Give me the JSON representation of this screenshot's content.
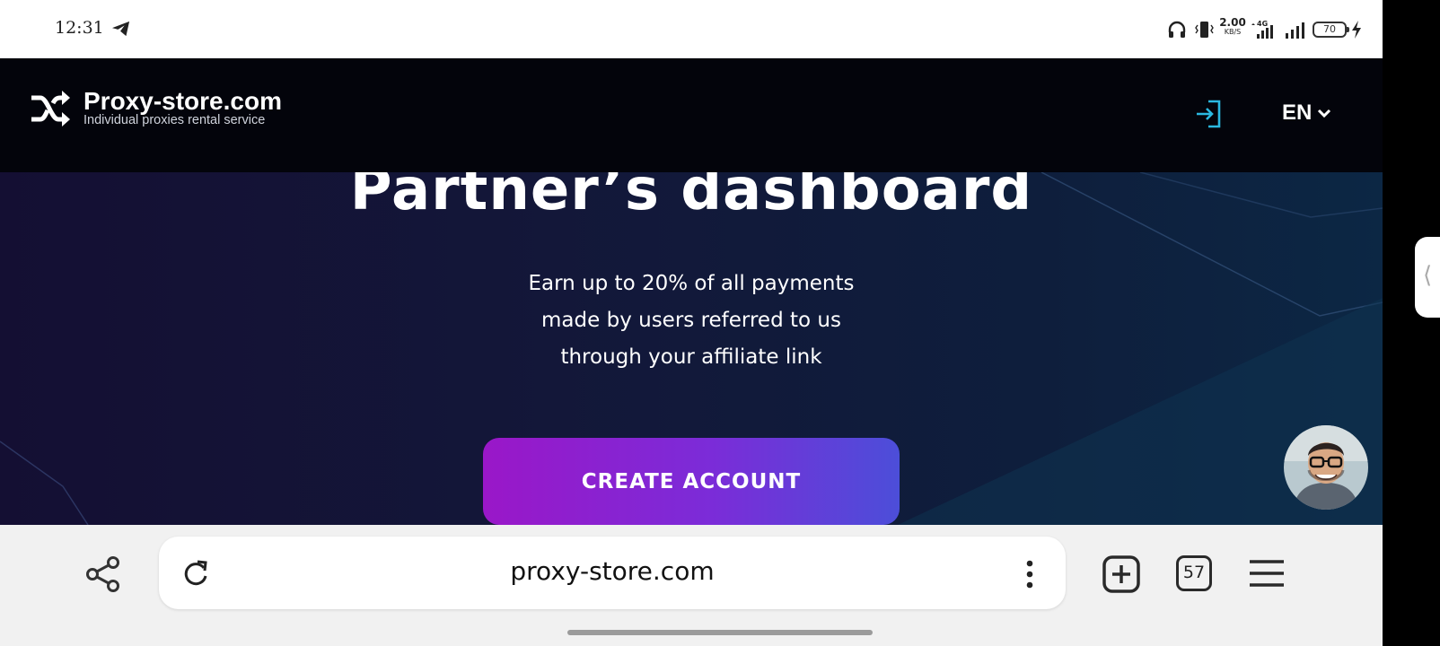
{
  "status_bar": {
    "time": "12:31",
    "net_speed_value": "2.00",
    "net_speed_unit": "KB/S",
    "network_type": "4G",
    "battery": "70",
    "icons": [
      "telegram-icon",
      "headphone-icon",
      "vibrate-icon",
      "signal-icon",
      "battery-icon",
      "charging-icon"
    ]
  },
  "header": {
    "logo_name": "Proxy-store.com",
    "logo_tagline": "Individual proxies rental service",
    "language": "EN",
    "accent": "#2bb8e0"
  },
  "hero": {
    "title": "Partner’s dashboard",
    "subtitle_lines": [
      "Earn up to 20% of all payments",
      "made by users referred to us",
      "through your affiliate link"
    ],
    "cta_label": "CREATE ACCOUNT",
    "cta_gradient": [
      "#9a17c8",
      "#4c4ed9"
    ]
  },
  "side_handle": {
    "glyph": "⟨"
  },
  "browser": {
    "url": "proxy-store.com",
    "tab_count": "57"
  }
}
